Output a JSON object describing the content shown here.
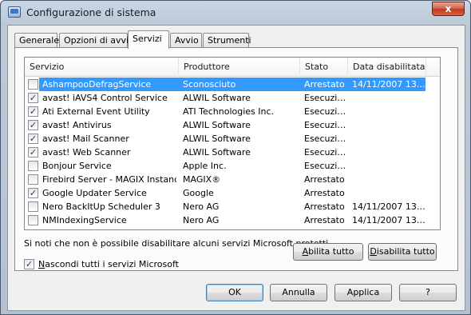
{
  "window": {
    "title": "Configurazione di sistema",
    "close_label": "x"
  },
  "tabs": [
    {
      "label": "Generale"
    },
    {
      "label": "Opzioni di avvio"
    },
    {
      "label": "Servizi"
    },
    {
      "label": "Avvio"
    },
    {
      "label": "Strumenti"
    }
  ],
  "active_tab": "Servizi",
  "columns": {
    "service": "Servizio",
    "manufacturer": "Produttore",
    "status": "Stato",
    "disabled_date": "Data disabilitata"
  },
  "rows": [
    {
      "checked": false,
      "service": "AshampooDefragService",
      "manufacturer": "Sconosciuto",
      "status": "Arrestato",
      "date": "14/11/2007 13.…",
      "selected": true
    },
    {
      "checked": true,
      "service": "avast! iAVS4 Control Service",
      "manufacturer": "ALWIL Software",
      "status": "Esecuzi…",
      "date": ""
    },
    {
      "checked": true,
      "service": "Ati External Event Utility",
      "manufacturer": "ATI Technologies Inc.",
      "status": "Esecuzi…",
      "date": ""
    },
    {
      "checked": true,
      "service": "avast! Antivirus",
      "manufacturer": "ALWIL Software",
      "status": "Esecuzi…",
      "date": ""
    },
    {
      "checked": true,
      "service": "avast! Mail Scanner",
      "manufacturer": "ALWIL Software",
      "status": "Esecuzi…",
      "date": ""
    },
    {
      "checked": true,
      "service": "avast! Web Scanner",
      "manufacturer": "ALWIL Software",
      "status": "Esecuzi…",
      "date": ""
    },
    {
      "checked": false,
      "service": "Bonjour Service",
      "manufacturer": "Apple Inc.",
      "status": "Esecuzi…",
      "date": ""
    },
    {
      "checked": false,
      "service": "Firebird Server - MAGIX Instance",
      "manufacturer": "MAGIX®",
      "status": "Arrestato",
      "date": ""
    },
    {
      "checked": true,
      "service": "Google Updater Service",
      "manufacturer": "Google",
      "status": "Arrestato",
      "date": ""
    },
    {
      "checked": false,
      "service": "Nero BackItUp Scheduler 3",
      "manufacturer": "Nero AG",
      "status": "Arrestato",
      "date": "14/11/2007 13.…"
    },
    {
      "checked": false,
      "service": "NMIndexingService",
      "manufacturer": "Nero AG",
      "status": "Arrestato",
      "date": "14/11/2007 13.…"
    }
  ],
  "note": "Si noti che non è possibile disabilitare alcuni servizi Microsoft protetti.",
  "enable_all": {
    "accel": "A",
    "rest": "bilita tutto"
  },
  "disable_all": {
    "accel": "D",
    "rest": "isabilita tutto"
  },
  "hide_ms": {
    "checked": true,
    "accel": "N",
    "rest": "ascondi tutti i servizi Microsoft"
  },
  "buttons": {
    "ok": "OK",
    "cancel": "Annulla",
    "apply": "Applica",
    "help": "?"
  },
  "colors": {
    "selection": "#3399ff",
    "close_button": "#c0391c"
  }
}
